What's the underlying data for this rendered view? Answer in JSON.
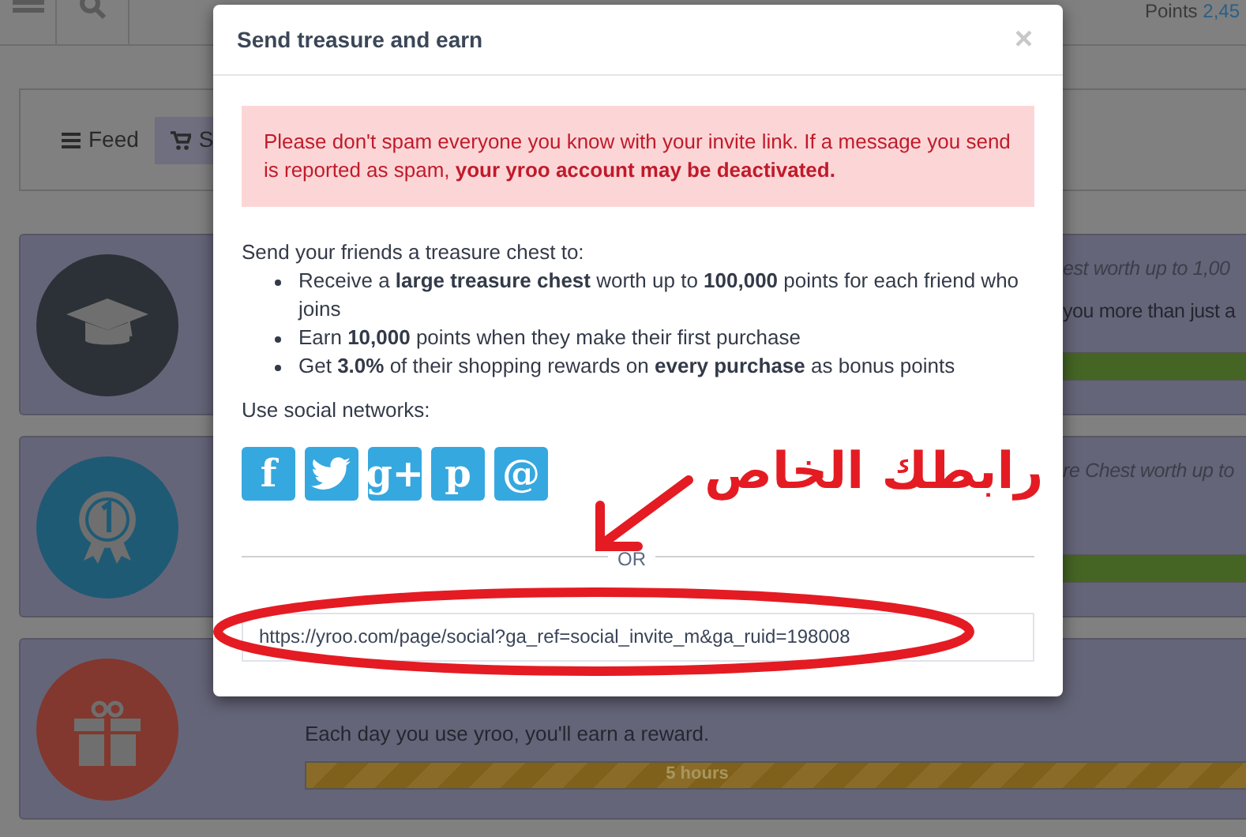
{
  "top_bar": {
    "points_label": "Points",
    "points_value": "2,45"
  },
  "feed_tabs": [
    {
      "label": "Feed",
      "selected": false
    },
    {
      "label": "S",
      "selected": true
    }
  ],
  "cards": [
    {
      "color": "#2c3137",
      "lines": [
        {
          "kind": "italic",
          "text": "est worth up to 1,00"
        },
        {
          "kind": "plain",
          "text": "you more than just a"
        }
      ],
      "bar": {
        "kind": "green",
        "level": 1
      }
    },
    {
      "color": "#1f5a75",
      "lines": [
        {
          "kind": "italic",
          "text": "re Chest worth up to"
        }
      ],
      "bar": {
        "kind": "green",
        "level": 1
      }
    },
    {
      "color": "#82382e",
      "bar": {
        "kind": "striped",
        "level": 1,
        "label": "5 hours"
      },
      "description": "Each day you use yroo, you'll earn a reward."
    }
  ],
  "modal": {
    "title": "Send treasure and earn",
    "close": "×",
    "alert": "Please don't spam everyone you know with your invite link. If a message you send is reported as spam, **your yroo account may be deactivated.**",
    "intro": "Send your friends a treasure chest to:",
    "bullets": [
      "Receive a **large treasure chest** worth up to **100,000** points for each friend who joins",
      "Earn **10,000** points when they make their first purchase",
      "Get **3.0%** of their shopping rewards on **every purchase** as bonus points"
    ],
    "social_label": "Use social networks:",
    "social": [
      {
        "kind": "glyph",
        "glyph": "f"
      },
      {
        "kind": "bird"
      },
      {
        "kind": "glyph",
        "glyph": "g+"
      },
      {
        "kind": "glyph",
        "glyph": "p"
      },
      {
        "kind": "glyph",
        "glyph": "@"
      }
    ],
    "divider_text": "OR",
    "url": "https://yroo.com/page/social?ga_ref=social_invite_m&ga_ruid=198008"
  },
  "annotation": {
    "text": "رابطك الخاص"
  }
}
